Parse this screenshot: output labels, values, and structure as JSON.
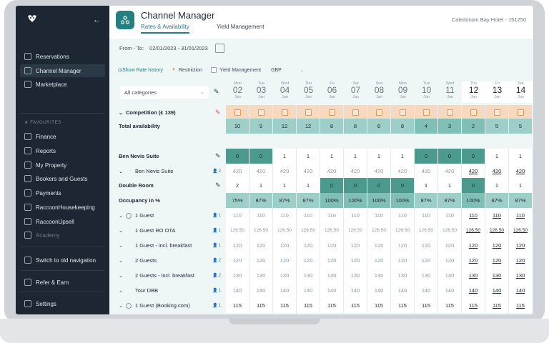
{
  "sidebar": {
    "items": [
      {
        "label": "Reservations",
        "icon": "calendar-icon"
      },
      {
        "label": "Channel Manager",
        "icon": "network-icon"
      },
      {
        "label": "Marketplace",
        "icon": "store-icon"
      }
    ],
    "favourites_label": "FAVOURITES",
    "favourites": [
      {
        "label": "Finance",
        "icon": "finance-icon"
      },
      {
        "label": "Reports",
        "icon": "reports-icon"
      },
      {
        "label": "My Property",
        "icon": "property-icon"
      },
      {
        "label": "Bookers and Guests",
        "icon": "guests-icon"
      },
      {
        "label": "Payments",
        "icon": "payments-icon"
      },
      {
        "label": "RaccoonHousekeeping",
        "icon": "housekeeping-icon"
      },
      {
        "label": "RaccoonUpsell",
        "icon": "upsell-icon"
      },
      {
        "label": "Academy",
        "icon": "academy-icon"
      }
    ],
    "switch_label": "Switch to old navigation",
    "refer_label": "Refer & Earn",
    "settings_label": "Settings"
  },
  "header": {
    "title": "Channel Manager",
    "tabs": [
      "Rates & Availability",
      "Yield Management"
    ],
    "hotel": "Caledonian Bay Hotel - 151250"
  },
  "toolbar": {
    "from_to_label": "From - To:",
    "date_range": "02/01/2023 - 31/01/2023",
    "show_rate_history": "Show Rate history",
    "restriction": "Restriction",
    "yield_management": "Yield Management",
    "currency": "GBP",
    "category": "All categories"
  },
  "days": [
    {
      "dw": "Mon",
      "dn": "02",
      "dm": "Jan"
    },
    {
      "dw": "Tue",
      "dn": "03",
      "dm": "Jan"
    },
    {
      "dw": "Wed",
      "dn": "04",
      "dm": "Jan"
    },
    {
      "dw": "Thu",
      "dn": "05",
      "dm": "Jan"
    },
    {
      "dw": "Fri",
      "dn": "06",
      "dm": "Jan"
    },
    {
      "dw": "Sat",
      "dn": "07",
      "dm": "Jan"
    },
    {
      "dw": "Sun",
      "dn": "08",
      "dm": "Jan"
    },
    {
      "dw": "Mon",
      "dn": "09",
      "dm": "Jan"
    },
    {
      "dw": "Tue",
      "dn": "10",
      "dm": "Jan"
    },
    {
      "dw": "Wed",
      "dn": "11",
      "dm": "Jan"
    },
    {
      "dw": "Thu",
      "dn": "12",
      "dm": "Jan"
    },
    {
      "dw": "Fri",
      "dn": "13",
      "dm": "Jan"
    },
    {
      "dw": "Sat",
      "dn": "14",
      "dm": "Jan"
    }
  ],
  "rows": [
    {
      "label": "Competition (£ 139)",
      "bold": true,
      "expand": "⌄",
      "type": "comp"
    },
    {
      "label": "Total availability",
      "bold": true,
      "type": "avail",
      "values": [
        "10",
        "9",
        "12",
        "12",
        "8",
        "8",
        "8",
        "8",
        "4",
        "3",
        "2",
        "5",
        "5"
      ]
    },
    {
      "label": "Ben Nevis Suite",
      "bold": true,
      "type": "room",
      "values": [
        "0",
        "0",
        "1",
        "1",
        "1",
        "1",
        "1",
        "1",
        "0",
        "0",
        "0",
        "1",
        "1"
      ]
    },
    {
      "label": "Ben Nevis Suite",
      "bold": false,
      "expand": "⌄",
      "meta": "2",
      "type": "rate",
      "values": [
        "420",
        "420",
        "420",
        "420",
        "420",
        "420",
        "420",
        "420",
        "420",
        "420",
        "420",
        "420",
        "420"
      ]
    },
    {
      "label": "Double Room",
      "bold": true,
      "type": "room",
      "values": [
        "2",
        "1",
        "1",
        "1",
        "0",
        "0",
        "0",
        "0",
        "1",
        "1",
        "0",
        "1",
        "1"
      ]
    },
    {
      "label": "Occupancy in %",
      "bold": true,
      "type": "occ",
      "values": [
        "75%",
        "87%",
        "87%",
        "87%",
        "100%",
        "100%",
        "100%",
        "100%",
        "87%",
        "87%",
        "100%",
        "87%",
        "87%"
      ]
    },
    {
      "label": "1 Guest",
      "bold": false,
      "expand": "⌄",
      "circle": true,
      "meta": "1",
      "type": "rate",
      "values": [
        "110",
        "110",
        "110",
        "110",
        "110",
        "110",
        "110",
        "110",
        "110",
        "110",
        "110",
        "110",
        "110"
      ]
    },
    {
      "label": "1 Guest RO OTA",
      "bold": false,
      "expand": "⌄",
      "meta": "1",
      "type": "rate",
      "values": [
        "126.50",
        "126.50",
        "126.50",
        "126.50",
        "126.50",
        "126.50",
        "126.50",
        "126.50",
        "126.50",
        "126.50",
        "126.50",
        "126.50",
        "126.50"
      ]
    },
    {
      "label": "1 Guest - incl. breakfast",
      "bold": false,
      "expand": "⌄",
      "meta": "1",
      "type": "rate",
      "values": [
        "120",
        "120",
        "120",
        "120",
        "120",
        "120",
        "120",
        "120",
        "120",
        "120",
        "120",
        "120",
        "120"
      ]
    },
    {
      "label": "2 Guests",
      "bold": false,
      "expand": "⌄",
      "meta": "2",
      "type": "rate",
      "values": [
        "120",
        "120",
        "120",
        "120",
        "120",
        "120",
        "120",
        "120",
        "120",
        "120",
        "120",
        "120",
        "120"
      ]
    },
    {
      "label": "2 Guests - incl. breakfast",
      "bold": false,
      "expand": "⌄",
      "meta": "2",
      "type": "rate",
      "values": [
        "130",
        "130",
        "130",
        "130",
        "130",
        "130",
        "130",
        "130",
        "130",
        "130",
        "130",
        "130",
        "130"
      ]
    },
    {
      "label": "Tour DBB",
      "bold": false,
      "expand": "⌄",
      "meta": "1",
      "type": "rate",
      "values": [
        "140",
        "140",
        "140",
        "140",
        "140",
        "140",
        "140",
        "140",
        "140",
        "140",
        "140",
        "140",
        "140"
      ]
    },
    {
      "label": "1 Guest (Booking.com)",
      "bold": false,
      "expand": "⌄",
      "circle": true,
      "meta": "1",
      "type": "rate2",
      "values": [
        "115",
        "115",
        "115",
        "115",
        "115",
        "115",
        "115",
        "115",
        "115",
        "115",
        "115",
        "115",
        "115"
      ]
    }
  ]
}
